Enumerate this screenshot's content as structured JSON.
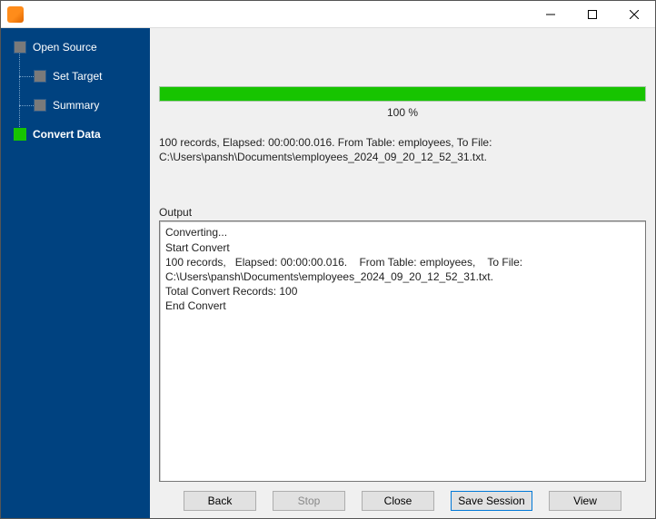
{
  "sidebar": {
    "steps": [
      {
        "label": "Open Source"
      },
      {
        "label": "Set Target"
      },
      {
        "label": "Summary"
      },
      {
        "label": "Convert Data"
      }
    ]
  },
  "progress": {
    "percent_label": "100 %"
  },
  "summary": "100 records,   Elapsed: 00:00:00.016.    From Table: employees,    To File: C:\\Users\\pansh\\Documents\\employees_2024_09_20_12_52_31.txt.",
  "output_label": "Output",
  "output_text": "Converting...\nStart Convert\n100 records,   Elapsed: 00:00:00.016.    From Table: employees,    To File: C:\\Users\\pansh\\Documents\\employees_2024_09_20_12_52_31.txt.\nTotal Convert Records: 100\nEnd Convert",
  "buttons": {
    "back": "Back",
    "stop": "Stop",
    "close": "Close",
    "save_session": "Save Session",
    "view": "View"
  }
}
